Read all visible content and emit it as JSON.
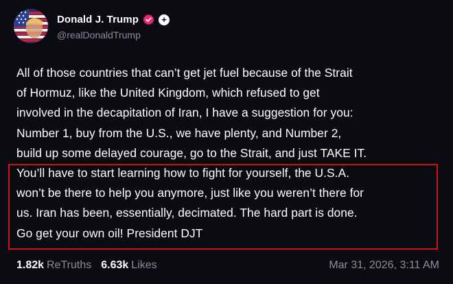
{
  "author": {
    "display_name": "Donald J. Trump",
    "handle": "@realDonaldTrump",
    "verified_icon": "verified-badge-icon",
    "plus_icon": "plus-icon",
    "plus_glyph": "+"
  },
  "post": {
    "lines": [
      "All of those countries that can’t get jet fuel because of the Strait",
      "of Hormuz, like the United Kingdom, which refused to get",
      "involved in the decapitation of Iran, I have a suggestion for you:",
      "Number 1, buy from the U.S., we have plenty, and Number 2,",
      "build up some delayed courage, go to the Strait, and just TAKE IT.",
      "You’ll have to start learning how to fight for yourself, the U.S.A.",
      "won’t be there to help you anymore, just like you weren’t there for",
      "us. Iran has been, essentially, decimated. The hard part is done.",
      "Go get your own oil! President DJT"
    ]
  },
  "stats": {
    "retruths_count": "1.82k",
    "retruths_label": "ReTruths",
    "likes_count": "6.63k",
    "likes_label": "Likes",
    "timestamp": "Mar 31, 2026, 3:11 AM"
  },
  "colors": {
    "background": "#0b0b12",
    "text": "#ffffff",
    "muted": "#8b8d9b",
    "highlight_border": "#d0121b",
    "verified": "#e8286a"
  }
}
